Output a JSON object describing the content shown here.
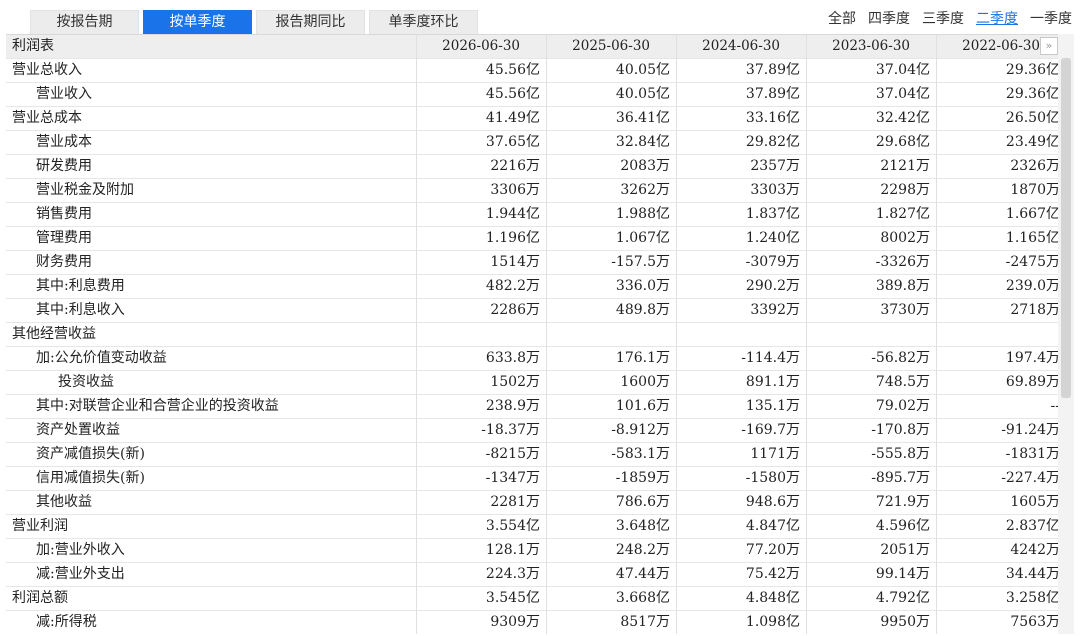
{
  "tabs": [
    "按报告期",
    "按单季度",
    "报告期同比",
    "单季度环比"
  ],
  "periods": [
    "全部",
    "四季度",
    "三季度",
    "二季度",
    "一季度"
  ],
  "table": {
    "header_label": "利润表",
    "dates": [
      "2026-06-30",
      "2025-06-30",
      "2024-06-30",
      "2023-06-30",
      "2022-06-30"
    ],
    "next_icon": "»",
    "rows": [
      {
        "label": "营业总收入",
        "values": [
          "45.56亿",
          "40.05亿",
          "37.89亿",
          "37.04亿",
          "29.36亿"
        ]
      },
      {
        "label": "营业收入",
        "values": [
          "45.56亿",
          "40.05亿",
          "37.89亿",
          "37.04亿",
          "29.36亿"
        ]
      },
      {
        "label": "营业总成本",
        "values": [
          "41.49亿",
          "36.41亿",
          "33.16亿",
          "32.42亿",
          "26.50亿"
        ]
      },
      {
        "label": "营业成本",
        "values": [
          "37.65亿",
          "32.84亿",
          "29.82亿",
          "29.68亿",
          "23.49亿"
        ]
      },
      {
        "label": "研发费用",
        "values": [
          "2216万",
          "2083万",
          "2357万",
          "2121万",
          "2326万"
        ]
      },
      {
        "label": "营业税金及附加",
        "values": [
          "3306万",
          "3262万",
          "3303万",
          "2298万",
          "1870万"
        ]
      },
      {
        "label": "销售费用",
        "values": [
          "1.944亿",
          "1.988亿",
          "1.837亿",
          "1.827亿",
          "1.667亿"
        ]
      },
      {
        "label": "管理费用",
        "values": [
          "1.196亿",
          "1.067亿",
          "1.240亿",
          "8002万",
          "1.165亿"
        ]
      },
      {
        "label": "财务费用",
        "values": [
          "1514万",
          "-157.5万",
          "-3079万",
          "-3326万",
          "-2475万"
        ]
      },
      {
        "label": "其中:利息费用",
        "values": [
          "482.2万",
          "336.0万",
          "290.2万",
          "389.8万",
          "239.0万"
        ]
      },
      {
        "label": "其中:利息收入",
        "values": [
          "2286万",
          "489.8万",
          "3392万",
          "3730万",
          "2718万"
        ]
      },
      {
        "label": "其他经营收益",
        "values": [
          "",
          "",
          "",
          "",
          ""
        ]
      },
      {
        "label": "加:公允价值变动收益",
        "values": [
          "633.8万",
          "176.1万",
          "-114.4万",
          "-56.82万",
          "197.4万"
        ]
      },
      {
        "label": "投资收益",
        "values": [
          "1502万",
          "1600万",
          "891.1万",
          "748.5万",
          "69.89万"
        ]
      },
      {
        "label": "其中:对联营企业和合营企业的投资收益",
        "values": [
          "238.9万",
          "101.6万",
          "135.1万",
          "79.02万",
          "--"
        ]
      },
      {
        "label": "资产处置收益",
        "values": [
          "-18.37万",
          "-8.912万",
          "-169.7万",
          "-170.8万",
          "-91.24万"
        ]
      },
      {
        "label": "资产减值损失(新)",
        "values": [
          "-8215万",
          "-583.1万",
          "1171万",
          "-555.8万",
          "-1831万"
        ]
      },
      {
        "label": "信用减值损失(新)",
        "values": [
          "-1347万",
          "-1859万",
          "-1580万",
          "-895.7万",
          "-227.4万"
        ]
      },
      {
        "label": "其他收益",
        "values": [
          "2281万",
          "786.6万",
          "948.6万",
          "721.9万",
          "1605万"
        ]
      },
      {
        "label": "营业利润",
        "values": [
          "3.554亿",
          "3.648亿",
          "4.847亿",
          "4.596亿",
          "2.837亿"
        ]
      },
      {
        "label": "加:营业外收入",
        "values": [
          "128.1万",
          "248.2万",
          "77.20万",
          "2051万",
          "4242万"
        ]
      },
      {
        "label": "减:营业外支出",
        "values": [
          "224.3万",
          "47.44万",
          "75.42万",
          "99.14万",
          "34.44万"
        ]
      },
      {
        "label": "利润总额",
        "values": [
          "3.545亿",
          "3.668亿",
          "4.848亿",
          "4.792亿",
          "3.258亿"
        ]
      },
      {
        "label": "减:所得税",
        "values": [
          "9309万",
          "8517万",
          "1.098亿",
          "9950万",
          "7563万"
        ]
      }
    ]
  }
}
